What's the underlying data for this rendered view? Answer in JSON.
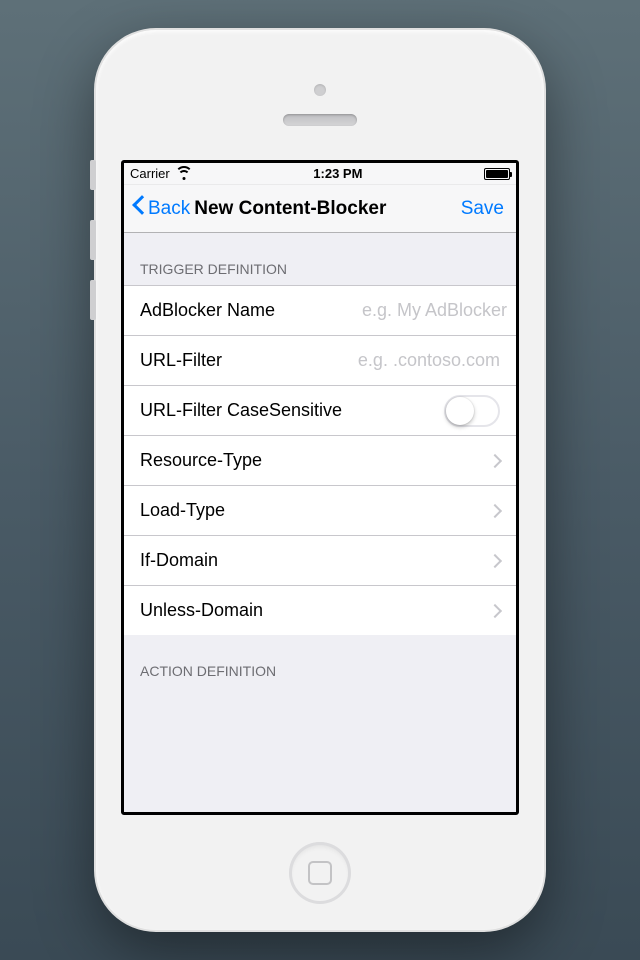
{
  "status": {
    "carrier": "Carrier",
    "time": "1:23 PM"
  },
  "nav": {
    "back": "Back",
    "title": "New Content-Blocker",
    "save": "Save"
  },
  "sections": {
    "trigger": {
      "header": "TRIGGER DEFINITION",
      "rows": {
        "name": {
          "label": "AdBlocker Name",
          "placeholder": "e.g. My AdBlocker",
          "value": ""
        },
        "urlfilter": {
          "label": "URL-Filter",
          "placeholder": "e.g. .contoso.com",
          "value": ""
        },
        "casesens": {
          "label": "URL-Filter CaseSensitive",
          "on": false
        },
        "restype": {
          "label": "Resource-Type"
        },
        "loadtype": {
          "label": "Load-Type"
        },
        "ifdomain": {
          "label": "If-Domain"
        },
        "unlessdom": {
          "label": "Unless-Domain"
        }
      }
    },
    "action": {
      "header": "ACTION DEFINITION"
    }
  }
}
